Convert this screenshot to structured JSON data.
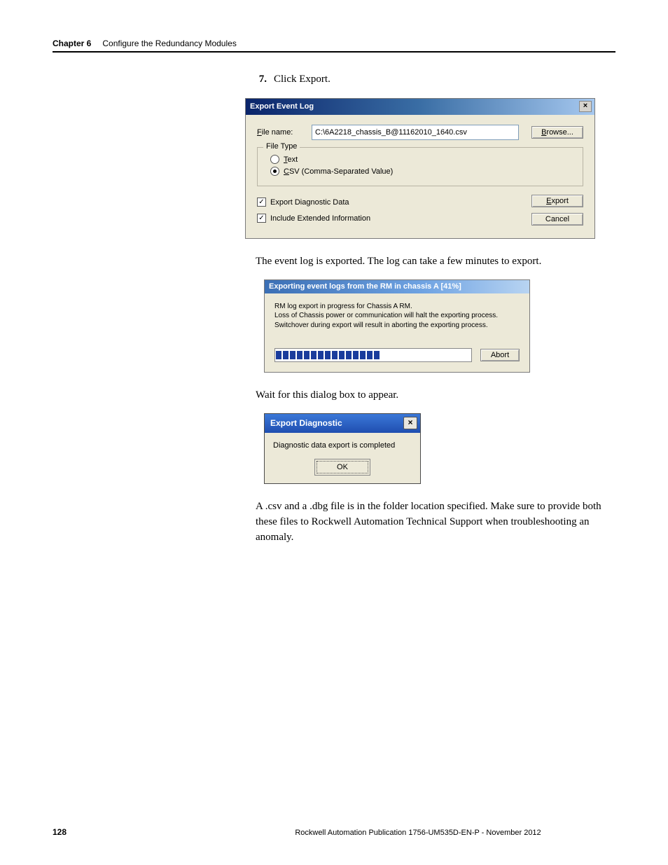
{
  "header": {
    "chapter": "Chapter 6",
    "title": "Configure the Redundancy Modules"
  },
  "step7": {
    "num": "7.",
    "text": "Click Export."
  },
  "dialog1": {
    "title": "Export Event Log",
    "file_label": "File name:",
    "file_value": "C:\\6A2218_chassis_B@11162010_1640.csv",
    "browse": "Browse...",
    "fieldset_legend": "File Type",
    "radio_text": "Text",
    "radio_csv": "CSV (Comma-Separated Value)",
    "chk_diag": "Export Diagnostic Data",
    "chk_ext": "Include Extended Information",
    "export": "Export",
    "cancel": "Cancel"
  },
  "para1": "The event log is exported. The log can take a few minutes to export.",
  "dialog2": {
    "title": "Exporting event logs from the RM in chassis A [41%]",
    "line1": "RM log export in progress for Chassis A RM.",
    "line2": "Loss of Chassis power or communication will halt the exporting process.",
    "line3": "Switchover during export will result in aborting the exporting process.",
    "abort": "Abort"
  },
  "para2": "Wait for this dialog box to appear.",
  "dialog3": {
    "title": "Export Diagnostic",
    "msg": "Diagnostic data export is completed",
    "ok": "OK"
  },
  "para3": "A .csv and a .dbg file is in the folder location specified. Make sure to provide both these files to Rockwell Automation Technical Support when troubleshooting an anomaly.",
  "footer": {
    "page": "128",
    "pub": "Rockwell Automation Publication 1756-UM535D-EN-P - November 2012"
  }
}
